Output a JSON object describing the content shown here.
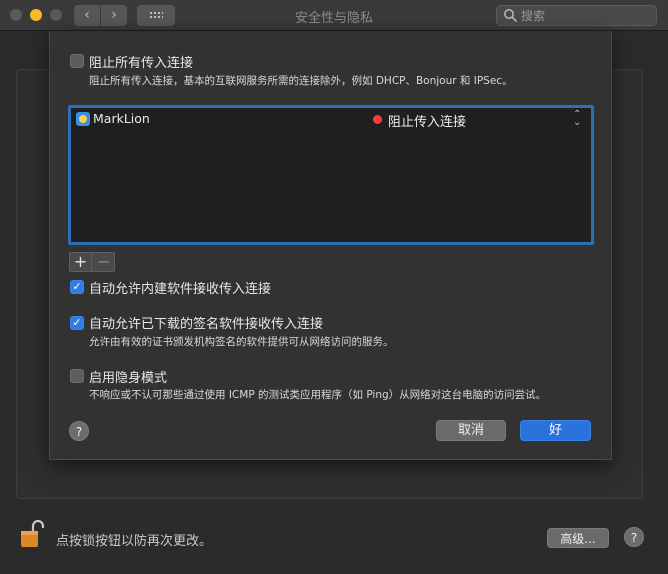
{
  "window": {
    "title": "安全性与隐私",
    "search_placeholder": "搜索",
    "nav_back": "‹",
    "nav_forward": "›"
  },
  "firewall_options": {
    "block_all": {
      "label": "阻止所有传入连接",
      "description": "阻止所有传入连接，基本的互联网服务所需的连接除外，例如 DHCP、Bonjour 和 IPSec。",
      "checked": false
    },
    "app_list": [
      {
        "name": "MarkLion",
        "status": "阻止传入连接",
        "status_color": "#ff3b3b"
      }
    ],
    "add_button": "+",
    "remove_button": "−",
    "allow_builtin": {
      "label": "自动允许内建软件接收传入连接",
      "checked": true
    },
    "allow_signed": {
      "label": "自动允许已下载的签名软件接收传入连接",
      "description": "允许由有效的证书颁发机构签名的软件提供可从网络访问的服务。",
      "checked": true
    },
    "stealth_mode": {
      "label": "启用隐身模式",
      "description": "不响应或不认可那些通过使用 ICMP 的测试类应用程序（如 Ping）从网络对这台电脑的访问尝试。",
      "checked": false
    },
    "help": "?",
    "cancel": "取消",
    "ok": "好"
  },
  "footer": {
    "lock_text": "点按锁按钮以防再次更改。",
    "advanced": "高级...",
    "help": "?"
  },
  "colors": {
    "accent": "#2a72dc",
    "list_border": "#2d6fb6"
  }
}
